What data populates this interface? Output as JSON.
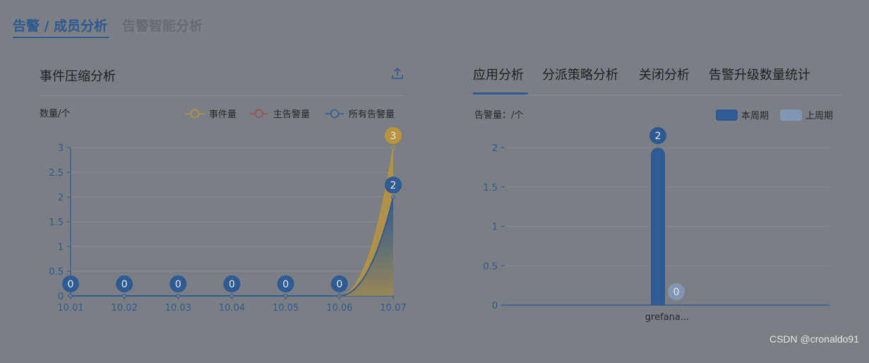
{
  "top_tabs": {
    "active": "告警 / 成员分析",
    "inactive": "告警智能分析"
  },
  "colors": {
    "events": "#b8943e",
    "main_alerts": "#9e4e55",
    "all_alerts": "#2f5a93",
    "this_week": "#2f5a93",
    "last_week": "#8196b4",
    "axis": "#2f5a93"
  },
  "left_card": {
    "title": "事件压缩分析",
    "upload_icon": "upload-icon",
    "y_unit": "数量/个"
  },
  "right_card": {
    "tabs": [
      "应用分析",
      "分派策略分析",
      "关闭分析",
      "告警升级数量统计"
    ],
    "y_unit": "告警量：/个"
  },
  "chart_data": [
    {
      "type": "area",
      "x": [
        "10.01",
        "10.02",
        "10.03",
        "10.04",
        "10.05",
        "10.06",
        "10.07"
      ],
      "series": [
        {
          "name": "事件量",
          "values": [
            0,
            0,
            0,
            0,
            0,
            0,
            3
          ]
        },
        {
          "name": "主告警量",
          "values": [
            0,
            0,
            0,
            0,
            0,
            0,
            2
          ]
        },
        {
          "name": "所有告警量",
          "values": [
            0,
            0,
            0,
            0,
            0,
            0,
            2
          ]
        }
      ],
      "ylabel": "数量/个",
      "ylim": [
        0,
        3
      ],
      "yticks": [
        "0",
        "0.5",
        "1",
        "1.5",
        "2",
        "2.5",
        "3"
      ],
      "legend": "top-right",
      "grid": true
    },
    {
      "type": "bar",
      "categories": [
        "grefana..."
      ],
      "series": [
        {
          "name": "本周期",
          "values": [
            2
          ]
        },
        {
          "name": "上周期",
          "values": [
            0
          ]
        }
      ],
      "ylabel": "告警量：/个",
      "ylim": [
        0,
        2
      ],
      "yticks": [
        "0",
        "0.5",
        "1",
        "1.5",
        "2"
      ],
      "legend": "top-right",
      "grid": true
    }
  ],
  "watermark": "CSDN @cronaldo91"
}
